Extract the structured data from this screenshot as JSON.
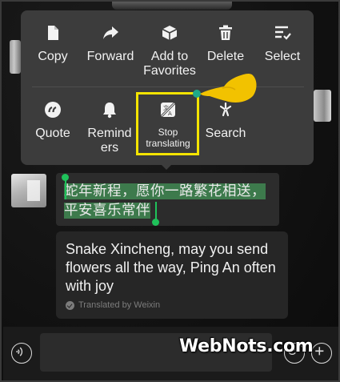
{
  "menu": {
    "row1": [
      {
        "label": "Copy",
        "icon": "copy-icon"
      },
      {
        "label": "Forward",
        "icon": "forward-icon"
      },
      {
        "label": "Add to\nFavorites",
        "icon": "favorites-cube-icon"
      },
      {
        "label": "Delete",
        "icon": "trash-icon"
      },
      {
        "label": "Select",
        "icon": "select-list-icon"
      }
    ],
    "row2": [
      {
        "label": "Quote",
        "icon": "quote-icon"
      },
      {
        "label": "Remind\ners",
        "icon": "bell-icon"
      },
      {
        "label": "Stop\ntranslating",
        "icon": "stop-translate-icon"
      },
      {
        "label": "Search",
        "icon": "search-sparkle-icon"
      }
    ]
  },
  "message": {
    "original_selected_1": "蛇年新程，愿你一路繁花相送，",
    "original_selected_2": "平安喜乐常伴",
    "translation": "Snake Xincheng, may you send flowers all the way, Ping An often with joy",
    "translated_by": "Translated by Weixin"
  },
  "watermark": "WebNots.com",
  "colors": {
    "highlight": "#f4e400",
    "selection": "#1fc15a",
    "hand": "#f2c200"
  }
}
